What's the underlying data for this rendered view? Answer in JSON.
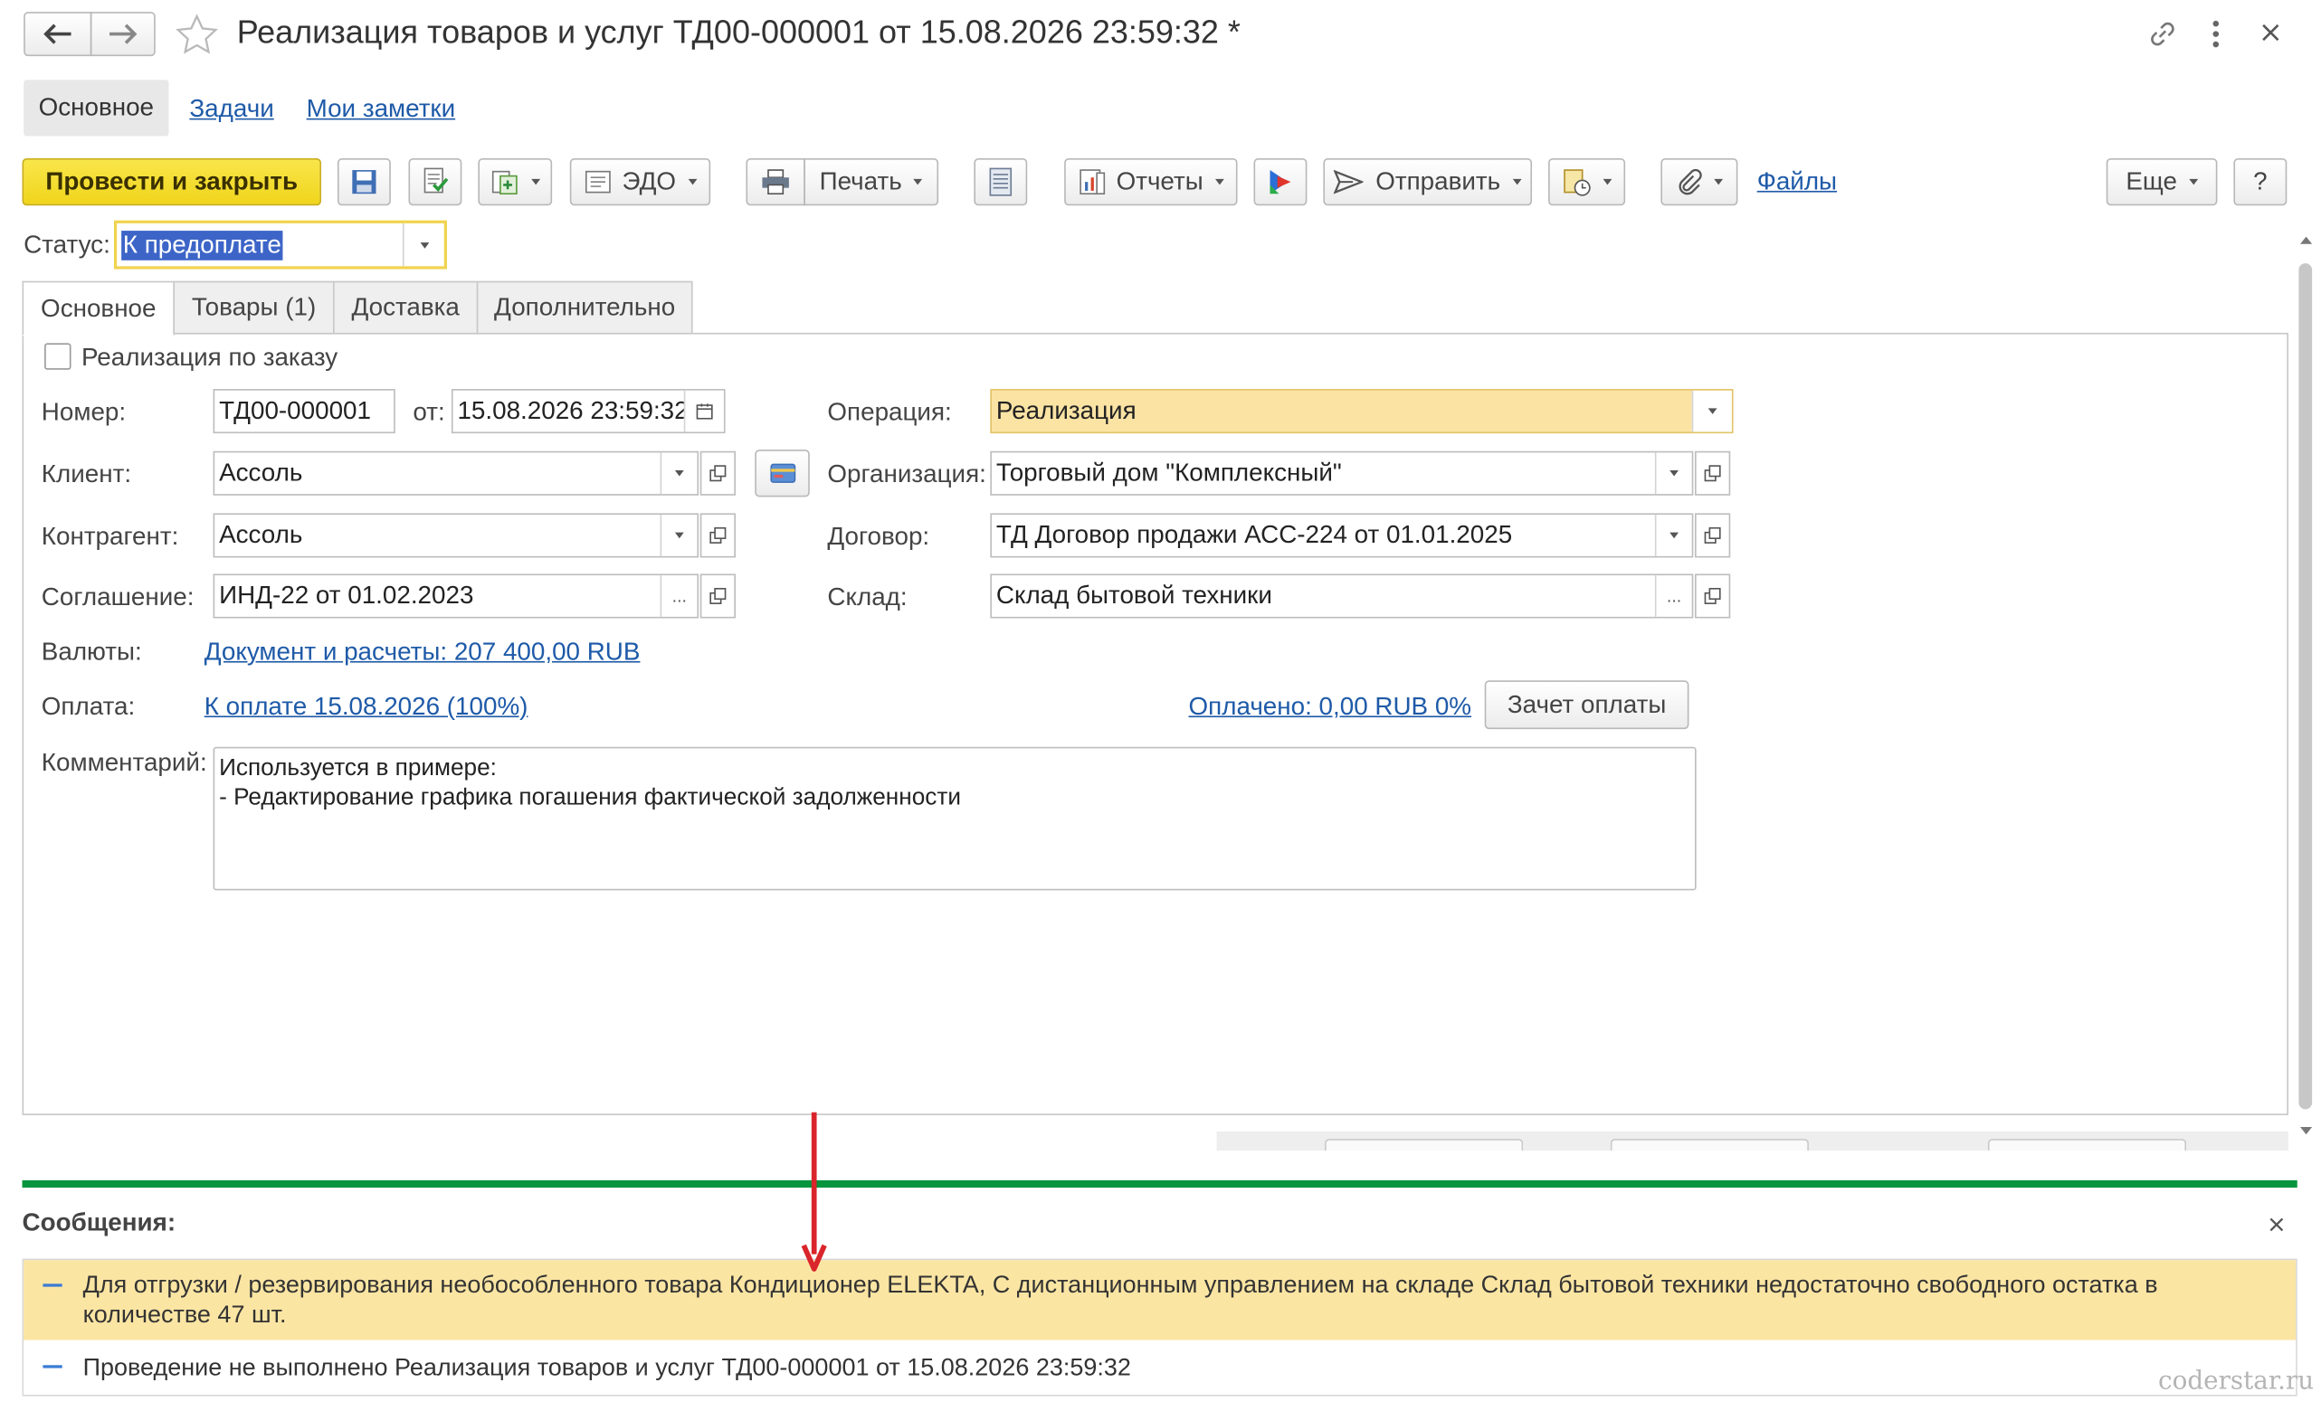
{
  "window": {
    "title": "Реализация товаров и услуг ТД00-000001 от 15.08.2026 23:59:32 *"
  },
  "nav_tabs": [
    "Основное",
    "Задачи",
    "Мои заметки"
  ],
  "toolbar": {
    "post_and_close": "Провести и закрыть",
    "edo": "ЭДО",
    "print": "Печать",
    "reports": "Отчеты",
    "send": "Отправить",
    "files": "Файлы",
    "more": "Еще",
    "help": "?"
  },
  "status": {
    "label": "Статус:",
    "value": "К предоплате"
  },
  "form_tabs": [
    "Основное",
    "Товары (1)",
    "Доставка",
    "Дополнительно"
  ],
  "form": {
    "by_order_label": "Реализация по заказу",
    "by_order_checked": false,
    "number_label": "Номер:",
    "number_value": "ТД00-000001",
    "date_label": "от:",
    "date_value": "15.08.2026 23:59:32",
    "client_label": "Клиент:",
    "client_value": "Ассоль",
    "counterparty_label": "Контрагент:",
    "counterparty_value": "Ассоль",
    "agreement_label": "Соглашение:",
    "agreement_value": "ИНД-22 от 01.02.2023",
    "currency_label": "Валюты:",
    "currency_link": "Документ и расчеты: 207 400,00 RUB",
    "payment_label": "Оплата:",
    "payment_link": "К оплате 15.08.2026 (100%)",
    "paid_link": "Оплачено: 0,00 RUB 0%",
    "offset_button": "Зачет оплаты",
    "operation_label": "Операция:",
    "operation_value": "Реализация",
    "organization_label": "Организация:",
    "organization_value": "Торговый дом \"Комплексный\"",
    "contract_label": "Договор:",
    "contract_value": "ТД Договор продажи АСС-224 от 01.01.2025",
    "warehouse_label": "Склад:",
    "warehouse_value": "Склад бытовой техники",
    "comment_label": "Комментарий:",
    "comment_line1": "Используется в примере:",
    "comment_line2": "- Редактирование графика погашения фактической задолженности"
  },
  "messages": {
    "header": "Сообщения:",
    "items": [
      {
        "line1": "Для отгрузки / резервирования необособленного товара Кондиционер ELEKTA, С дистанционным управлением на складе Склад бытовой техники недостаточно свободного остатка в",
        "line2": "количестве 47 шт."
      },
      {
        "line1": "Проведение не выполнено Реализация товаров и услуг ТД00-000001 от 15.08.2026 23:59:32"
      }
    ]
  },
  "watermark": "coderstar.ru",
  "colors": {
    "primary_button": "#f5df2f",
    "highlight_field": "#fbe3a4",
    "warning_message": "#fbe5a3",
    "separator_green": "#06953e",
    "arrow_red": "#d9252b",
    "link": "#1e5aa8"
  }
}
